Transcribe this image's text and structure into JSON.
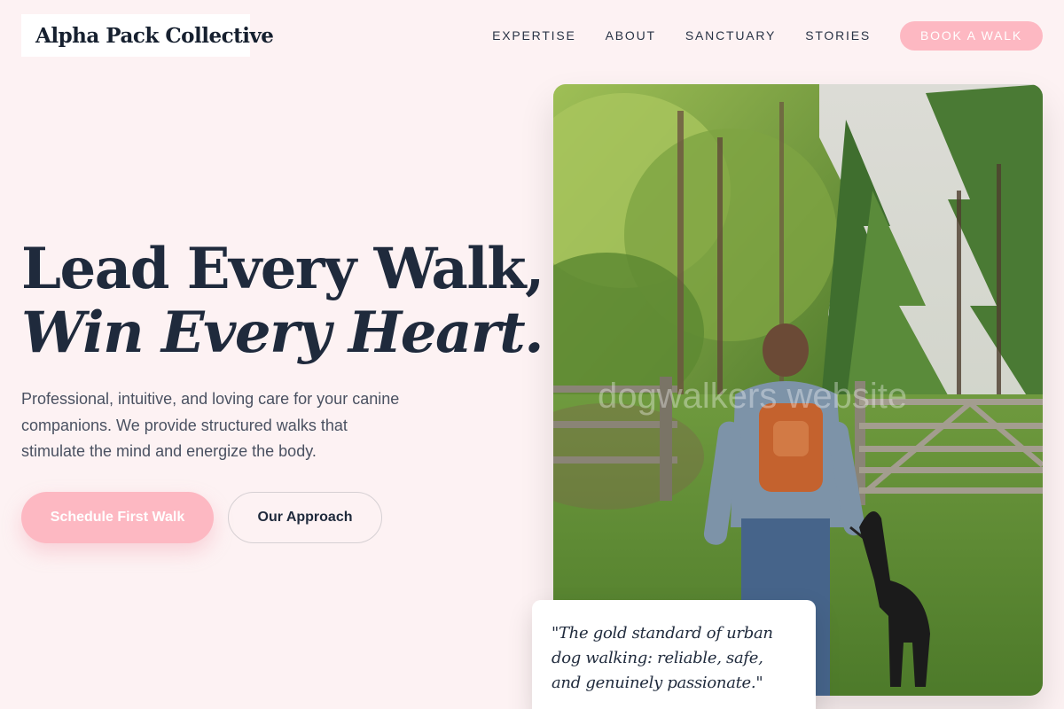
{
  "brand": {
    "name": "Alpha Pack Collective"
  },
  "nav": {
    "links": [
      "EXPERTISE",
      "ABOUT",
      "SANCTUARY",
      "STORIES"
    ],
    "cta_label": "BOOK A WALK"
  },
  "hero": {
    "headline_line1": "Lead Every Walk,",
    "headline_line2": "Win Every Heart.",
    "subtext": "Professional, intuitive, and loving care for your canine companions. We provide structured walks that stimulate the mind and energize the body.",
    "primary_cta": "Schedule First Walk",
    "secondary_cta": "Our Approach"
  },
  "photo": {
    "watermark": "dogwalkers website"
  },
  "testimonial": {
    "quote": "\"The gold standard of urban dog walking: reliable, safe, and genuinely passionate.\""
  },
  "colors": {
    "background": "#fdf2f3",
    "accent_pink": "#fdb8c2",
    "text_dark": "#1f2a3c"
  }
}
